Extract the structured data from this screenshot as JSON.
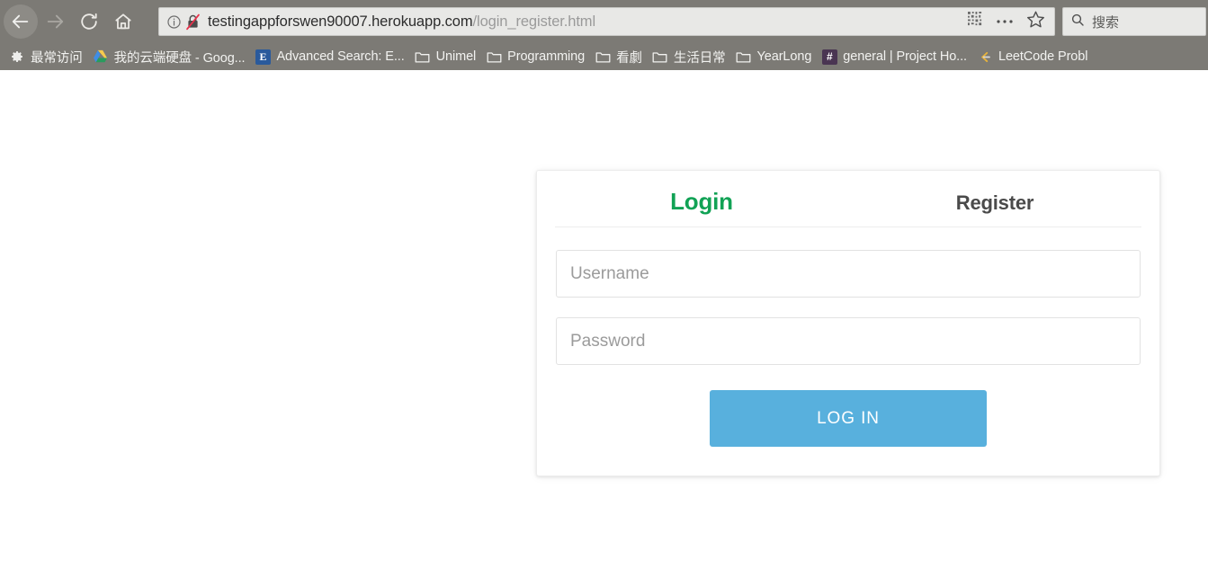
{
  "browser": {
    "nav": {
      "back_icon": "back-arrow-icon",
      "forward_icon": "forward-arrow-icon",
      "reload_icon": "reload-icon",
      "home_icon": "home-icon"
    },
    "urlbar": {
      "info_icon": "info-circle-icon",
      "security_icon": "crossed-out-lock-icon",
      "url_host": "testingappforswen90007.herokuapp.com",
      "url_path": "/login_register.html",
      "qr_icon": "qr-code-icon",
      "menu_icon": "page-actions-ellipsis-icon",
      "bookmark_icon": "star-outline-icon"
    },
    "search": {
      "icon": "search-magnifier-icon",
      "placeholder": "搜索"
    },
    "bookmarks": [
      {
        "label": "最常访问",
        "icon": "gear-icon",
        "icon_type": "gear"
      },
      {
        "label": "我的云端硬盘 - Goog...",
        "icon": "google-drive-icon",
        "icon_type": "drive"
      },
      {
        "label": "Advanced Search: E...",
        "icon": "ebsco-e-icon",
        "icon_type": "letter",
        "letter": "E",
        "color": "#2a5a9c"
      },
      {
        "label": "Unimel",
        "icon": "folder-icon",
        "icon_type": "folder"
      },
      {
        "label": "Programming",
        "icon": "folder-icon",
        "icon_type": "folder"
      },
      {
        "label": "看劇",
        "icon": "folder-icon",
        "icon_type": "folder"
      },
      {
        "label": "生活日常",
        "icon": "folder-icon",
        "icon_type": "folder"
      },
      {
        "label": "YearLong",
        "icon": "folder-icon",
        "icon_type": "folder"
      },
      {
        "label": "general | Project Ho...",
        "icon": "slack-channel-icon",
        "icon_type": "letter",
        "letter": "#",
        "color": "#4a3552"
      },
      {
        "label": "LeetCode Probl",
        "icon": "leetcode-icon",
        "icon_type": "leetcode"
      }
    ]
  },
  "login_card": {
    "tabs": {
      "login_label": "Login",
      "register_label": "Register",
      "active": "Login",
      "active_color": "#11a255",
      "inactive_color": "#4a4a4a"
    },
    "form": {
      "username": {
        "value": "",
        "placeholder": "Username"
      },
      "password": {
        "value": "",
        "placeholder": "Password"
      },
      "submit_label": "LOG IN",
      "submit_color": "#58b0dd"
    }
  }
}
